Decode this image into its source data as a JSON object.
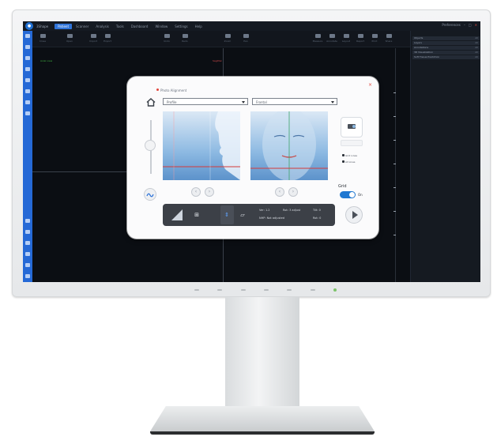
{
  "app": {
    "name": "3Shape"
  },
  "menu": {
    "items": [
      "Patient",
      "Scanner",
      "Analysis",
      "Tools",
      "Dashboard",
      "Window",
      "Settings",
      "Help"
    ],
    "active_index": 0
  },
  "menubar_right": {
    "label": "Preferences"
  },
  "toolbar": {
    "left_labels": [
      "Close",
      "Open",
      "Import",
      "Export"
    ],
    "middle_labels": [
      "Undo",
      "Redo",
      "Zoom",
      "Pan"
    ],
    "right_labels": [
      "Measure",
      "Annotate",
      "Layout",
      "Report",
      "Print",
      "Share"
    ]
  },
  "right_panel": {
    "rows": [
      {
        "label": "Objects",
        "value": "All"
      },
      {
        "label": "Layers",
        "value": "All"
      },
      {
        "label": "Annotations",
        "value": "All"
      },
      {
        "label": "3D Visualization",
        "value": "All"
      },
      {
        "label": "Soft Tissue Prediction",
        "value": "All"
      }
    ]
  },
  "viewport": {
    "left_mark": "Axial view",
    "right_mark": "Sagittal"
  },
  "dialog": {
    "title": "Photo Alignment",
    "close_icon": "close-icon",
    "select_left": "Profile",
    "select_right": "Frontal",
    "side_labels": [
      "Grid Lines",
      "All Lines"
    ],
    "grid_label": "Grid",
    "toggle_label": "On",
    "bottom_bar": {
      "text_a": "Ver: 1.2",
      "text_b": "NHP: Not adjusted",
      "text_c": "Rot: 3 adjust",
      "text_d": "Tilt: 0",
      "text_e": "Rot: 0"
    }
  },
  "colors": {
    "accent": "#2f74d9",
    "sidebar": "#2569d6",
    "screen_bg": "#0b0e13",
    "toggle": "#1f78d1",
    "close": "#e2463d"
  }
}
